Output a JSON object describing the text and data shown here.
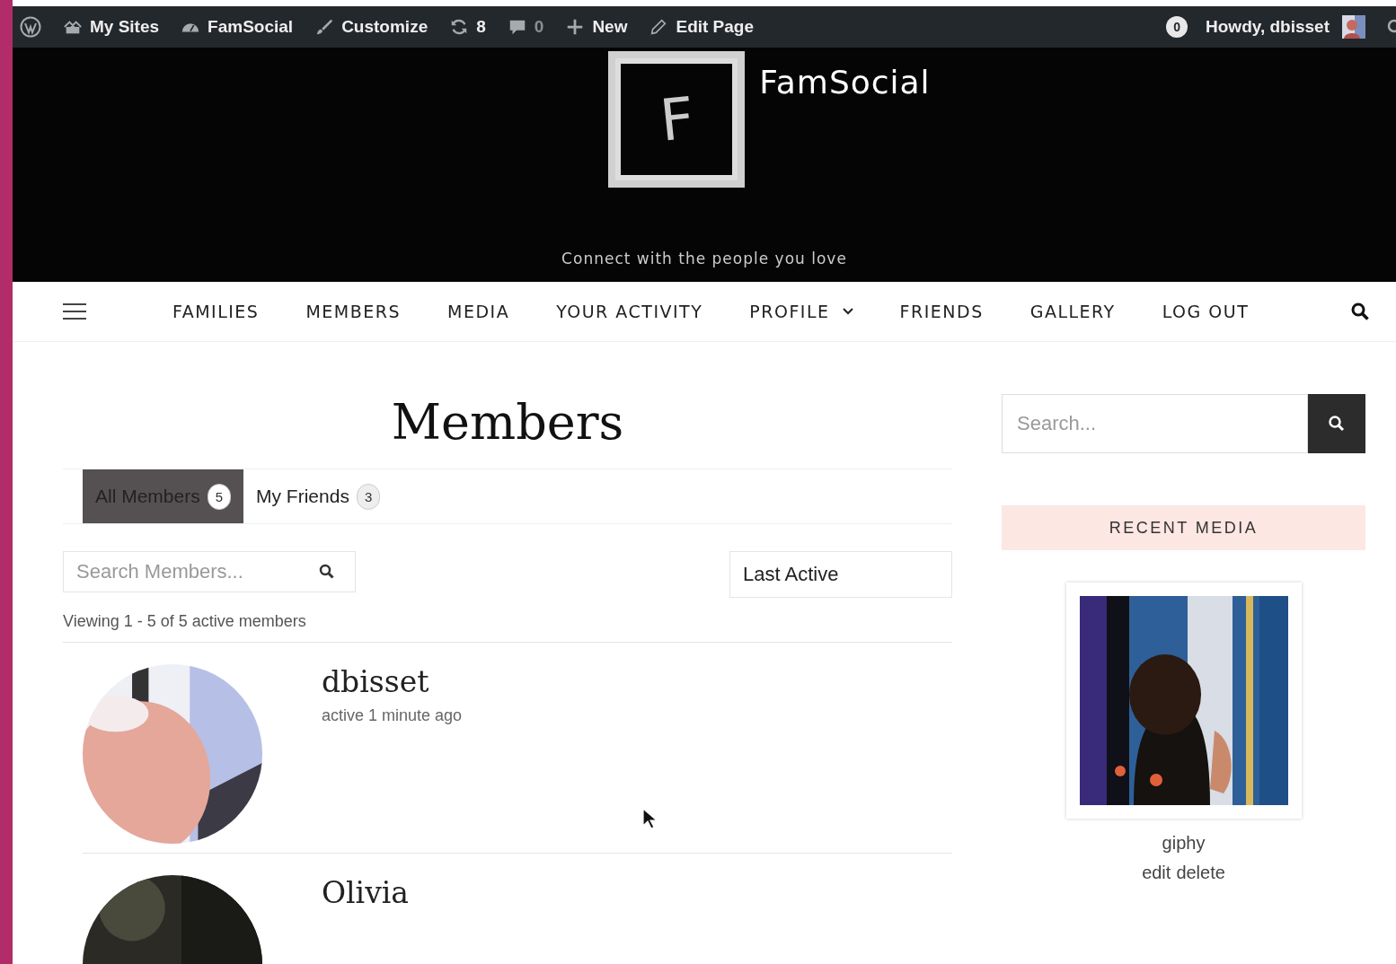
{
  "admin_bar": {
    "left": [
      {
        "kind": "wordpress"
      },
      {
        "kind": "sites",
        "label": "My Sites"
      },
      {
        "kind": "dashboard",
        "label": "FamSocial"
      },
      {
        "kind": "brush",
        "label": "Customize"
      },
      {
        "kind": "updates",
        "label": "8"
      },
      {
        "kind": "comments",
        "label": "0"
      },
      {
        "kind": "plus",
        "label": "New"
      },
      {
        "kind": "pencil",
        "label": "Edit Page"
      }
    ],
    "notifications": "0",
    "greeting": "Howdy, dbisset"
  },
  "header": {
    "logo_letter": "F",
    "site_title": "FamSocial",
    "tagline": "Connect with the people you love"
  },
  "nav": {
    "items": [
      {
        "label": "FAMILIES",
        "has_dropdown": false
      },
      {
        "label": "MEMBERS",
        "has_dropdown": false
      },
      {
        "label": "MEDIA",
        "has_dropdown": false
      },
      {
        "label": "YOUR ACTIVITY",
        "has_dropdown": false
      },
      {
        "label": "PROFILE",
        "has_dropdown": true
      },
      {
        "label": "FRIENDS",
        "has_dropdown": false
      },
      {
        "label": "GALLERY",
        "has_dropdown": false
      },
      {
        "label": "LOG OUT",
        "has_dropdown": false
      }
    ]
  },
  "page": {
    "title": "Members",
    "tabs": [
      {
        "label": "All Members",
        "count": "5",
        "selected": true
      },
      {
        "label": "My Friends",
        "count": "3",
        "selected": false
      }
    ],
    "search": {
      "placeholder": "Search Members..."
    },
    "order": {
      "value": "Last Active"
    },
    "count_text": "Viewing 1 - 5 of 5 active members",
    "members": [
      {
        "name": "dbisset",
        "activity": "active 1 minute ago"
      },
      {
        "name": "Olivia"
      }
    ]
  },
  "sidebar": {
    "search": {
      "placeholder": "Search..."
    },
    "widget_title": "RECENT MEDIA",
    "media": {
      "kind": "picture",
      "title": "giphy",
      "actions": [
        "edit",
        "delete"
      ]
    }
  }
}
